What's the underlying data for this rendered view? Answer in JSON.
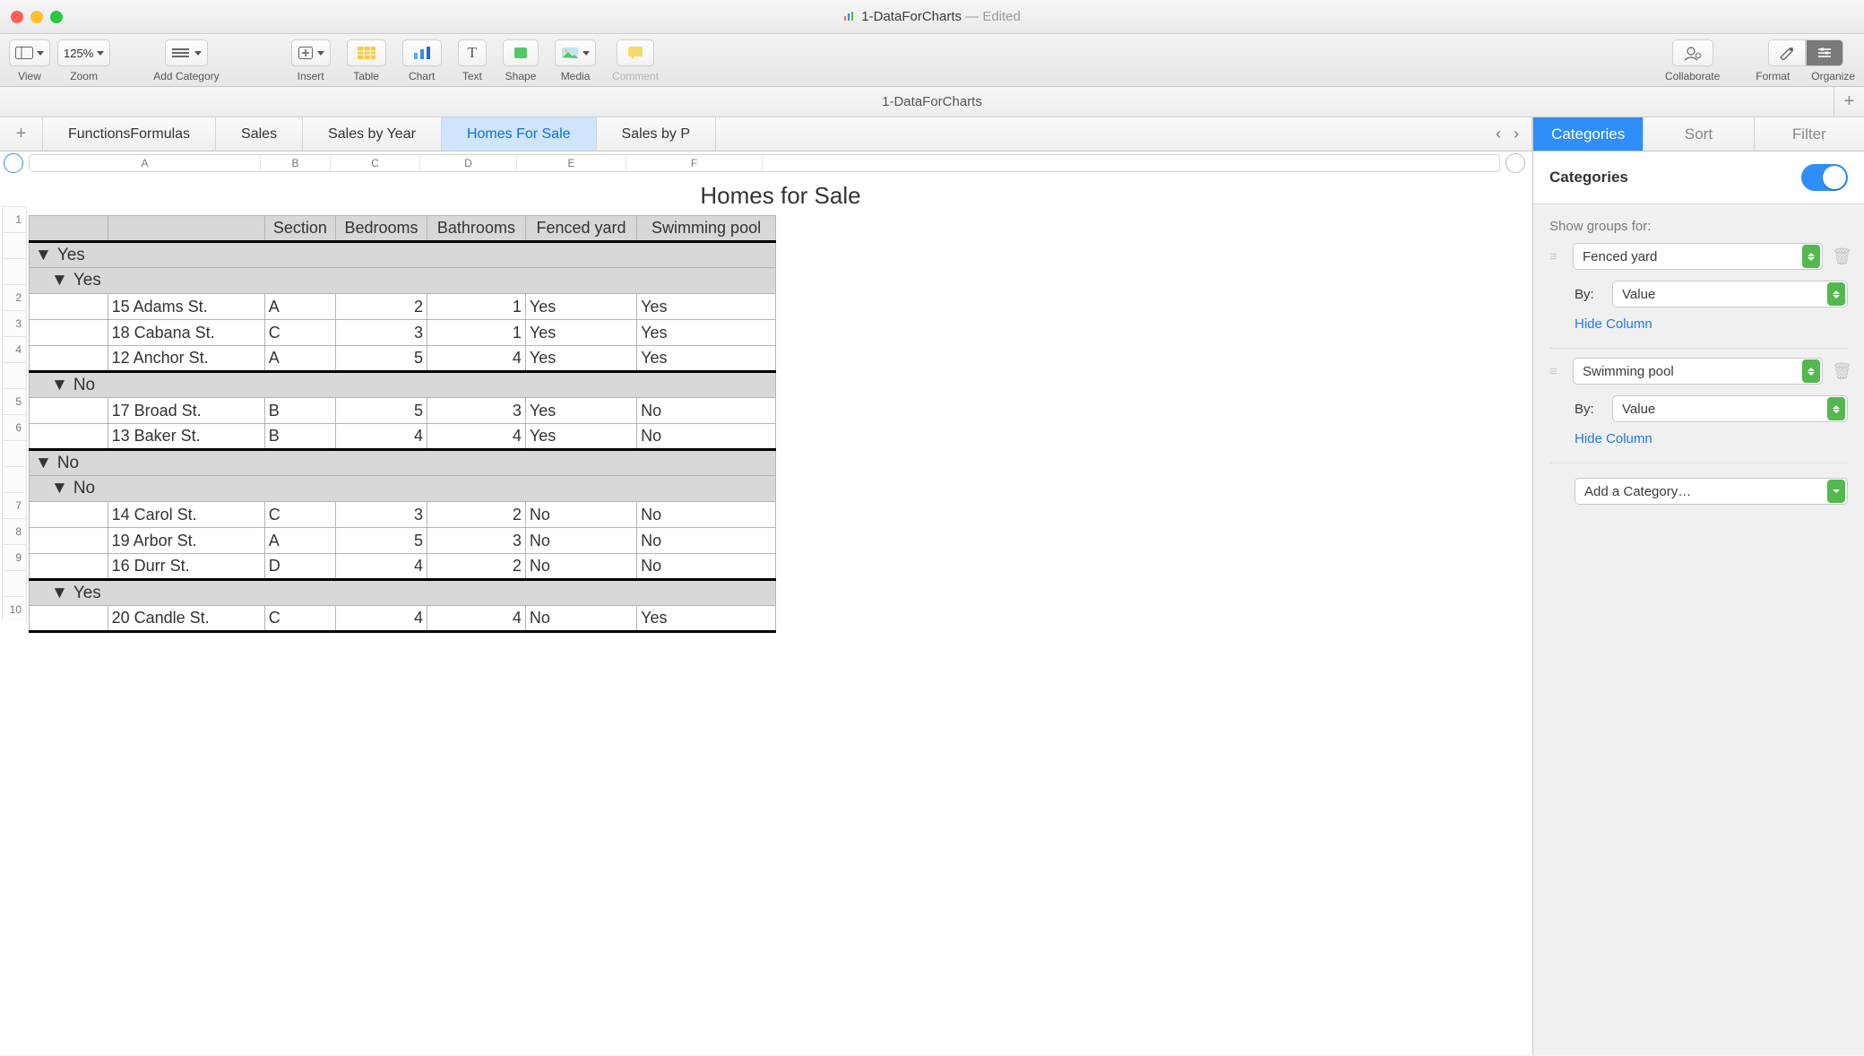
{
  "window": {
    "title": "1-DataForCharts",
    "editedSuffix": " — Edited",
    "docTitle": "1-DataForCharts"
  },
  "toolbar": {
    "view": "View",
    "zoom": "Zoom",
    "zoomValue": "125%",
    "addCategory": "Add Category",
    "insert": "Insert",
    "table": "Table",
    "chart": "Chart",
    "text": "Text",
    "shape": "Shape",
    "media": "Media",
    "comment": "Comment",
    "collaborate": "Collaborate",
    "format": "Format",
    "organize": "Organize"
  },
  "sheets": {
    "tabs": [
      "FunctionsFormulas",
      "Sales",
      "Sales by Year",
      "Homes For Sale",
      "Sales by P"
    ],
    "activeIndex": 3
  },
  "columns": [
    "A",
    "B",
    "C",
    "D",
    "E",
    "F"
  ],
  "table": {
    "title": "Homes for Sale",
    "headers": [
      "",
      "Section",
      "Bedrooms",
      "Bathrooms",
      "Fenced yard",
      "Swimming pool"
    ],
    "groups": [
      {
        "label": "Yes",
        "level": 1,
        "sub": [
          {
            "label": "Yes",
            "level": 2,
            "rows": [
              {
                "n": "2",
                "addr": "15 Adams St.",
                "sec": "A",
                "bed": "2",
                "bath": "1",
                "fence": "Yes",
                "pool": "Yes"
              },
              {
                "n": "3",
                "addr": "18 Cabana St.",
                "sec": "C",
                "bed": "3",
                "bath": "1",
                "fence": "Yes",
                "pool": "Yes"
              },
              {
                "n": "4",
                "addr": "12 Anchor St.",
                "sec": "A",
                "bed": "5",
                "bath": "4",
                "fence": "Yes",
                "pool": "Yes"
              }
            ]
          },
          {
            "label": "No",
            "level": 2,
            "rows": [
              {
                "n": "5",
                "addr": "17 Broad St.",
                "sec": "B",
                "bed": "5",
                "bath": "3",
                "fence": "Yes",
                "pool": "No"
              },
              {
                "n": "6",
                "addr": "13 Baker St.",
                "sec": "B",
                "bed": "4",
                "bath": "4",
                "fence": "Yes",
                "pool": "No"
              }
            ]
          }
        ]
      },
      {
        "label": "No",
        "level": 1,
        "sub": [
          {
            "label": "No",
            "level": 2,
            "rows": [
              {
                "n": "7",
                "addr": "14 Carol St.",
                "sec": "C",
                "bed": "3",
                "bath": "2",
                "fence": "No",
                "pool": "No"
              },
              {
                "n": "8",
                "addr": "19 Arbor St.",
                "sec": "A",
                "bed": "5",
                "bath": "3",
                "fence": "No",
                "pool": "No"
              },
              {
                "n": "9",
                "addr": "16 Durr St.",
                "sec": "D",
                "bed": "4",
                "bath": "2",
                "fence": "No",
                "pool": "No"
              }
            ]
          },
          {
            "label": "Yes",
            "level": 2,
            "rows": [
              {
                "n": "10",
                "addr": "20 Candle St.",
                "sec": "C",
                "bed": "4",
                "bath": "4",
                "fence": "No",
                "pool": "Yes"
              }
            ]
          }
        ]
      }
    ],
    "headerRowNum": "1"
  },
  "inspector": {
    "tabs": [
      "Categories",
      "Sort",
      "Filter"
    ],
    "activeIndex": 0,
    "heading": "Categories",
    "showGroupsLabel": "Show groups for:",
    "groups": [
      {
        "column": "Fenced yard",
        "byLabel": "By:",
        "byValue": "Value",
        "hide": "Hide Column"
      },
      {
        "column": "Swimming pool",
        "byLabel": "By:",
        "byValue": "Value",
        "hide": "Hide Column"
      }
    ],
    "addCategory": "Add a Category…"
  }
}
